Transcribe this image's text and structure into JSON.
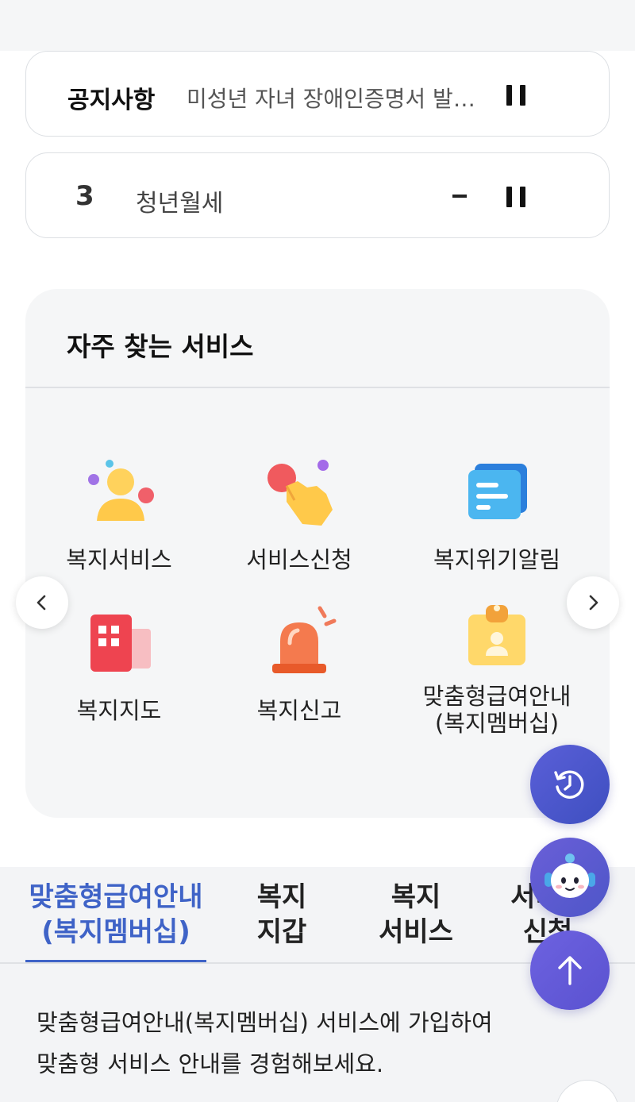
{
  "notice": {
    "label": "공지사항",
    "text": "미성년 자녀 장애인증명서 발급 관련 안내"
  },
  "ranking": {
    "rank": "3",
    "keyword": "청년월세",
    "change": "-"
  },
  "frequent_services": {
    "title": "자주 찾는 서비스",
    "items": [
      {
        "label": "복지서비스",
        "icon": "person-icon"
      },
      {
        "label": "서비스신청",
        "icon": "tap-hand-icon"
      },
      {
        "label": "복지위기알림",
        "icon": "message-card-icon"
      },
      {
        "label": "복지지도",
        "icon": "map-grid-icon"
      },
      {
        "label": "복지신고",
        "icon": "siren-icon"
      },
      {
        "label_line1": "맞춤형급여안내",
        "label_line2": "(복지멤버십)",
        "icon": "id-badge-icon"
      }
    ]
  },
  "tabs": [
    {
      "line1": "맞춤형급여안내",
      "line2": "(복지멤버십)",
      "active": true
    },
    {
      "line1": "복지",
      "line2": "지갑",
      "active": false
    },
    {
      "line1": "복지",
      "line2": "서비스",
      "active": false
    },
    {
      "line1": "서비스",
      "line2": "신청",
      "active": false
    }
  ],
  "content": {
    "line1": "맞춤형급여안내(복지멤버십) 서비스에 가입하여",
    "line2": "맞춤형 서비스 안내를 경험해보세요."
  },
  "colors": {
    "accent": "#3f63c7",
    "fab": "#5a52d0",
    "card_bg": "#f5f6f7"
  }
}
